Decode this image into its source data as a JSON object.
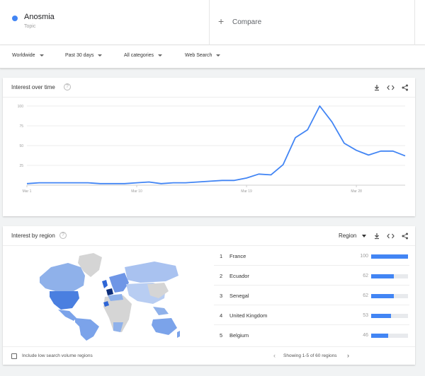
{
  "search_term": {
    "name": "Anosmia",
    "type": "Topic",
    "color": "#4285f4"
  },
  "compare": {
    "label": "Compare"
  },
  "filters": [
    {
      "label": "Worldwide"
    },
    {
      "label": "Past 30 days"
    },
    {
      "label": "All categories"
    },
    {
      "label": "Web Search"
    }
  ],
  "interest_over_time": {
    "title": "Interest over time",
    "icons": [
      "download-icon",
      "embed-icon",
      "share-icon"
    ]
  },
  "chart_data": {
    "type": "line",
    "x_labels": [
      "Mar 1",
      "Mar 10",
      "Mar 19",
      "Mar 28"
    ],
    "y_ticks": [
      25,
      50,
      75,
      100
    ],
    "ylim": [
      0,
      100
    ],
    "grid": true,
    "series": [
      {
        "color": "#4285f4",
        "values": [
          2,
          3,
          3,
          3,
          3,
          3,
          2,
          2,
          2,
          3,
          4,
          2,
          3,
          3,
          4,
          5,
          6,
          6,
          9,
          14,
          13,
          26,
          60,
          70,
          100,
          80,
          53,
          44,
          38,
          43,
          43,
          37
        ]
      }
    ]
  },
  "interest_by_region": {
    "title": "Interest by region",
    "selector": "Region",
    "icons": [
      "download-icon",
      "embed-icon",
      "share-icon"
    ],
    "rows": [
      {
        "rank": "1",
        "country": "France",
        "value": 100
      },
      {
        "rank": "2",
        "country": "Ecuador",
        "value": 62
      },
      {
        "rank": "3",
        "country": "Senegal",
        "value": 62
      },
      {
        "rank": "4",
        "country": "United Kingdom",
        "value": 53
      },
      {
        "rank": "5",
        "country": "Belgium",
        "value": 46
      }
    ],
    "checkbox_label": "Include low search volume regions",
    "pager_text": "Showing 1-5 of 60 regions"
  }
}
